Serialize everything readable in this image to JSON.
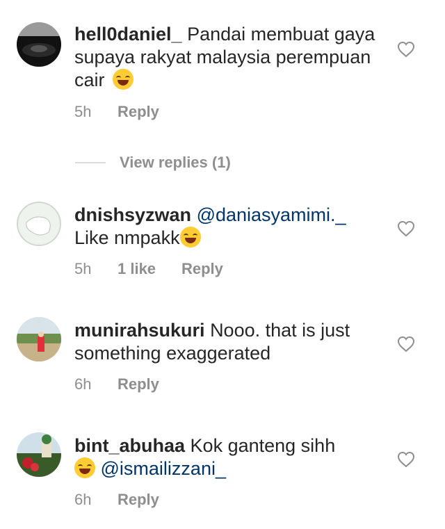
{
  "comments": [
    {
      "username": "hell0daniel_",
      "text": "Pandai membuat gaya supaya rakyat malaysia perempuan cair",
      "emoji": "rolling-on-floor-laughing",
      "time": "5h",
      "likes": "",
      "reply_label": "Reply"
    },
    {
      "username": "dnishsyzwan",
      "mention": "@daniasyamimi._",
      "text": "Like nmpakk",
      "emoji": "face-with-tears-of-joy",
      "time": "5h",
      "likes": "1 like",
      "reply_label": "Reply"
    },
    {
      "username": "munirahsukuri",
      "text": "Nooo. that is just something exaggerated",
      "time": "6h",
      "likes": "",
      "reply_label": "Reply"
    },
    {
      "username": "bint_abuhaa",
      "text": "Kok ganteng sihh",
      "emoji": "rolling-on-floor-laughing",
      "mention": "@ismailizzani_",
      "time": "6h",
      "likes": "",
      "reply_label": "Reply"
    }
  ],
  "view_replies_label": "View replies (1)",
  "colors": {
    "text": "#262626",
    "meta": "#8e8e8e",
    "mention": "#003569",
    "divider": "#dbdbdb"
  },
  "icons": [
    "heart-icon"
  ]
}
